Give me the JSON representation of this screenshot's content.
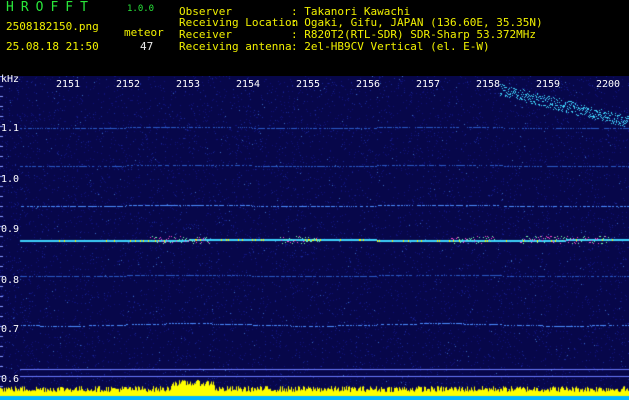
{
  "app": {
    "name": "HROFFT",
    "version": "1.0.0"
  },
  "file": {
    "name": "2508182150.png",
    "datetime": "25.08.18 21:50"
  },
  "meteor": {
    "label": "meteor",
    "count": "47"
  },
  "station": {
    "observer_label": "Observer",
    "observer": ": Takanori Kawachi",
    "location_label": "Receiving Location",
    "location": ": Ogaki, Gifu, JAPAN (136.60E, 35.35N)",
    "receiver_label": "Receiver",
    "receiver": ": R820T2(RTL-SDR) SDR-Sharp 53.372MHz",
    "antenna_label": "Receiving antenna",
    "antenna": ": 2el-HB9CV Vertical (el. E-W)"
  },
  "axis": {
    "y_unit": "kHz",
    "y_ticks": [
      "1.1",
      "1.0",
      "0.9",
      "0.8",
      "0.7",
      "0.6"
    ],
    "x_ticks": [
      "2151",
      "2152",
      "2153",
      "2154",
      "2155",
      "2156",
      "2157",
      "2158",
      "2159",
      "2200"
    ]
  },
  "colors": {
    "background": "#07074a",
    "label_green": "#29e63a",
    "label_yellow": "#f0f000",
    "signal_cyan": "#3fd6ff",
    "signal_yellow": "#ffff00"
  }
}
